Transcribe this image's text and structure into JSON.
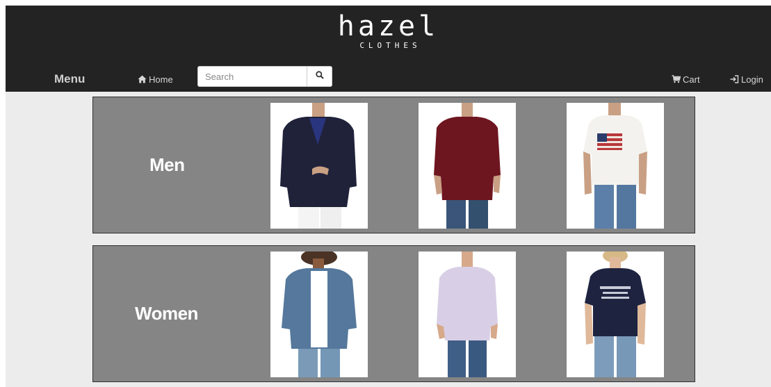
{
  "header": {
    "logo_main": "hazel",
    "logo_sub": "CLOTHES"
  },
  "nav": {
    "menu_label": "Menu",
    "home_label": "Home",
    "search_placeholder": "Search",
    "cart_label": "Cart",
    "login_label": "Login"
  },
  "icons": {
    "home": "home-icon",
    "search": "search-icon",
    "cart": "cart-icon",
    "login": "login-icon"
  },
  "categories": [
    {
      "label": "Men",
      "products": [
        "navy blazer",
        "burgundy button-down shirt",
        "flag graphic t-shirt"
      ]
    },
    {
      "label": "Women",
      "products": [
        "denim jacket",
        "lavender oxford shirt",
        "navy graphic t-shirt"
      ]
    }
  ],
  "colors": {
    "header_bg": "#232323",
    "page_bg": "#ececec",
    "panel_bg": "#858585",
    "panel_text": "#ffffff"
  }
}
